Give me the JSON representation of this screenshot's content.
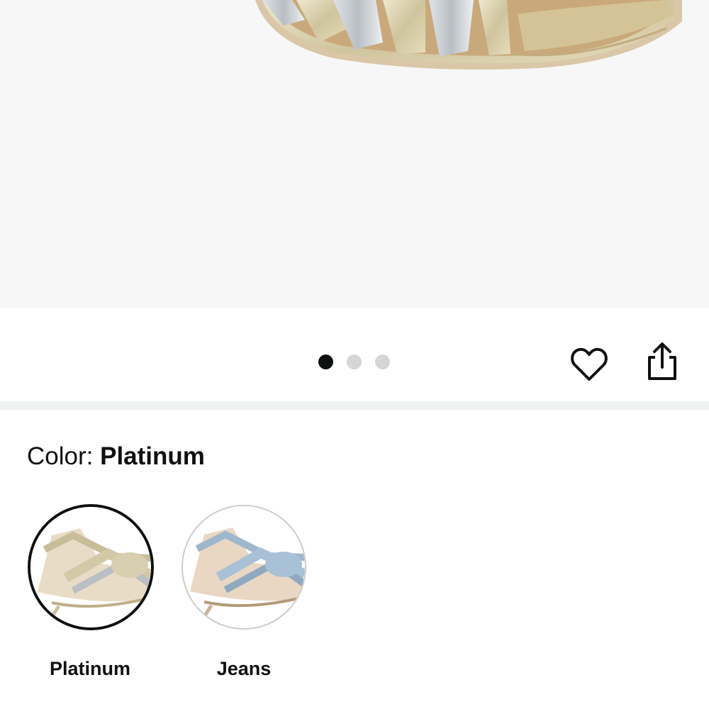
{
  "product_image": {
    "alt": "product-photo-sandal"
  },
  "carousel": {
    "dot_count": 3,
    "active_index": 0
  },
  "actions": {
    "wishlist_icon": "heart-icon",
    "share_icon": "share-icon"
  },
  "color": {
    "label": "Color: ",
    "selected": "Platinum",
    "options": [
      {
        "name": "Platinum",
        "tone": "#d8cfb0",
        "selected": true
      },
      {
        "name": "Jeans",
        "tone": "#a9c1d6",
        "selected": false
      }
    ]
  }
}
